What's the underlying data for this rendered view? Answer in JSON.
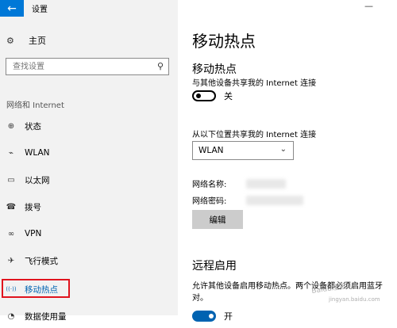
{
  "window": {
    "title": "设置",
    "minimize_glyph": "—",
    "back_glyph": "←"
  },
  "sidebar": {
    "home_label": "主页",
    "search_placeholder": "查找设置",
    "section_title": "网络和 Internet",
    "items": [
      {
        "label": "状态",
        "icon": "globe-icon",
        "glyph": "⊕",
        "active": false
      },
      {
        "label": "WLAN",
        "icon": "wifi-icon",
        "glyph": "⌁",
        "active": false
      },
      {
        "label": "以太网",
        "icon": "ethernet-icon",
        "glyph": "▭",
        "active": false
      },
      {
        "label": "拨号",
        "icon": "dialup-icon",
        "glyph": "☎",
        "active": false
      },
      {
        "label": "VPN",
        "icon": "vpn-icon",
        "glyph": "∞",
        "active": false
      },
      {
        "label": "飞行模式",
        "icon": "airplane-icon",
        "glyph": "✈",
        "active": false
      },
      {
        "label": "移动热点",
        "icon": "hotspot-icon",
        "glyph": "((·))",
        "active": true
      },
      {
        "label": "数据使用量",
        "icon": "data-usage-icon",
        "glyph": "◔",
        "active": false
      }
    ]
  },
  "main": {
    "page_title": "移动热点",
    "section_title": "移动热点",
    "share_desc": "与其他设备共享我的 Internet 连接",
    "toggle_state": "关",
    "from_label": "从以下位置共享我的 Internet 连接",
    "connection_select": "WLAN",
    "network_name_label": "网络名称:",
    "network_password_label": "网络密码:",
    "edit_button": "编辑",
    "remote_title": "远程启用",
    "remote_desc": "允许其他设备启用移动热点。两个设备都必须启用蓝牙 对。",
    "remote_toggle_state": "开"
  },
  "watermark": {
    "line1": "Baidu经验",
    "line2": "jingyan.baidu.com"
  },
  "colors": {
    "accent": "#0078d7",
    "active_text": "#0063b1",
    "highlight": "#e0141e"
  }
}
